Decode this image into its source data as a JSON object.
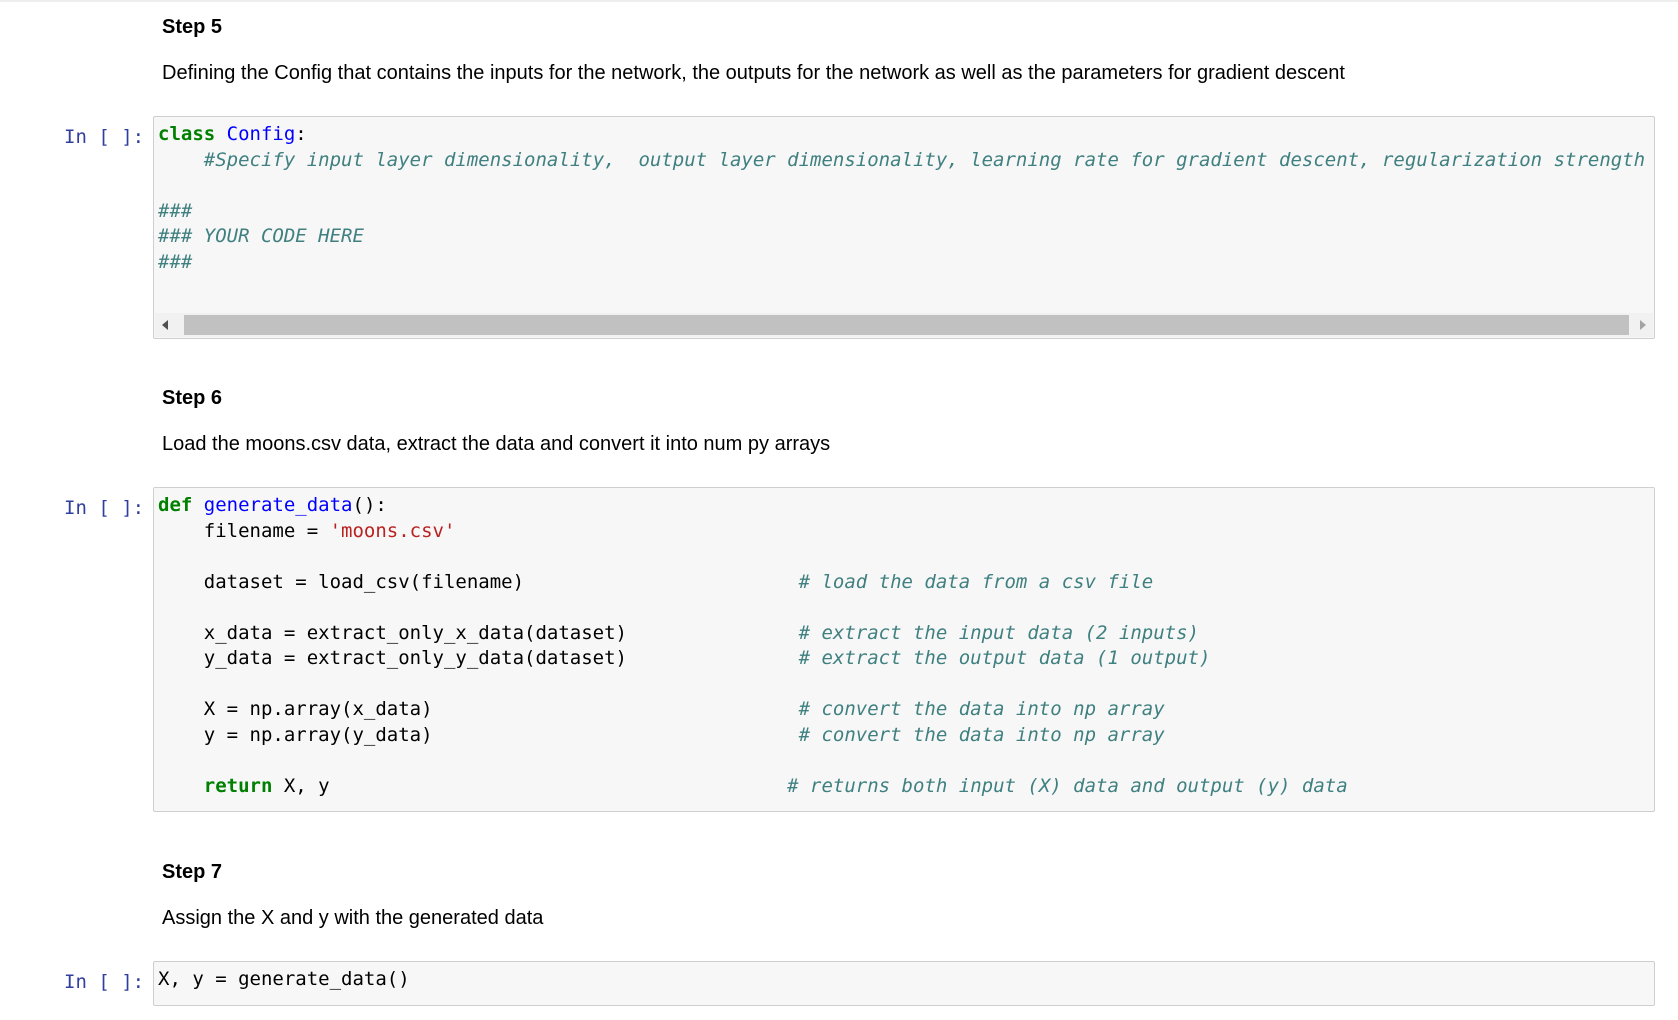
{
  "step5": {
    "heading": "Step 5",
    "description": "Defining the Config that contains the inputs for the network, the outputs for the network as well as the parameters for gradient descent",
    "prompt": "In [ ]:",
    "code": {
      "l1_kw": "class",
      "l1_name": "Config",
      "l1_rest": ":",
      "l2_indent": "    ",
      "l2_comment": "#Specify input layer dimensionality,  output layer dimensionality, learning rate for gradient descent, regularization strength",
      "l3": "###",
      "l4": "### YOUR CODE HERE",
      "l5": "###"
    }
  },
  "step6": {
    "heading": "Step 6",
    "description": "Load the moons.csv data, extract the data and convert it into num py arrays",
    "prompt": "In [ ]:",
    "code": {
      "def_kw": "def",
      "func_name": "generate_data",
      "def_rest": "():",
      "filename_lhs": "    filename = ",
      "filename_str": "'moons.csv'",
      "dataset_code": "    dataset = load_csv(filename)                        ",
      "dataset_comment": "# load the data from a csv file",
      "xdata_code": "    x_data = extract_only_x_data(dataset)               ",
      "xdata_comment": "# extract the input data (2 inputs)",
      "ydata_code": "    y_data = extract_only_y_data(dataset)               ",
      "ydata_comment": "# extract the output data (1 output)",
      "X_code": "    X = np.array(x_data)                                ",
      "X_comment": "# convert the data into np array",
      "y_code": "    y = np.array(y_data)                                ",
      "y_comment": "# convert the data into np array",
      "return_indent": "    ",
      "return_kw": "return",
      "return_rest": " X, y                                        ",
      "return_comment": "# returns both input (X) data and output (y) data"
    }
  },
  "step7": {
    "heading": "Step 7",
    "description": "Assign the X and y with the generated data",
    "prompt": "In [ ]:",
    "code": "X, y = generate_data()"
  }
}
